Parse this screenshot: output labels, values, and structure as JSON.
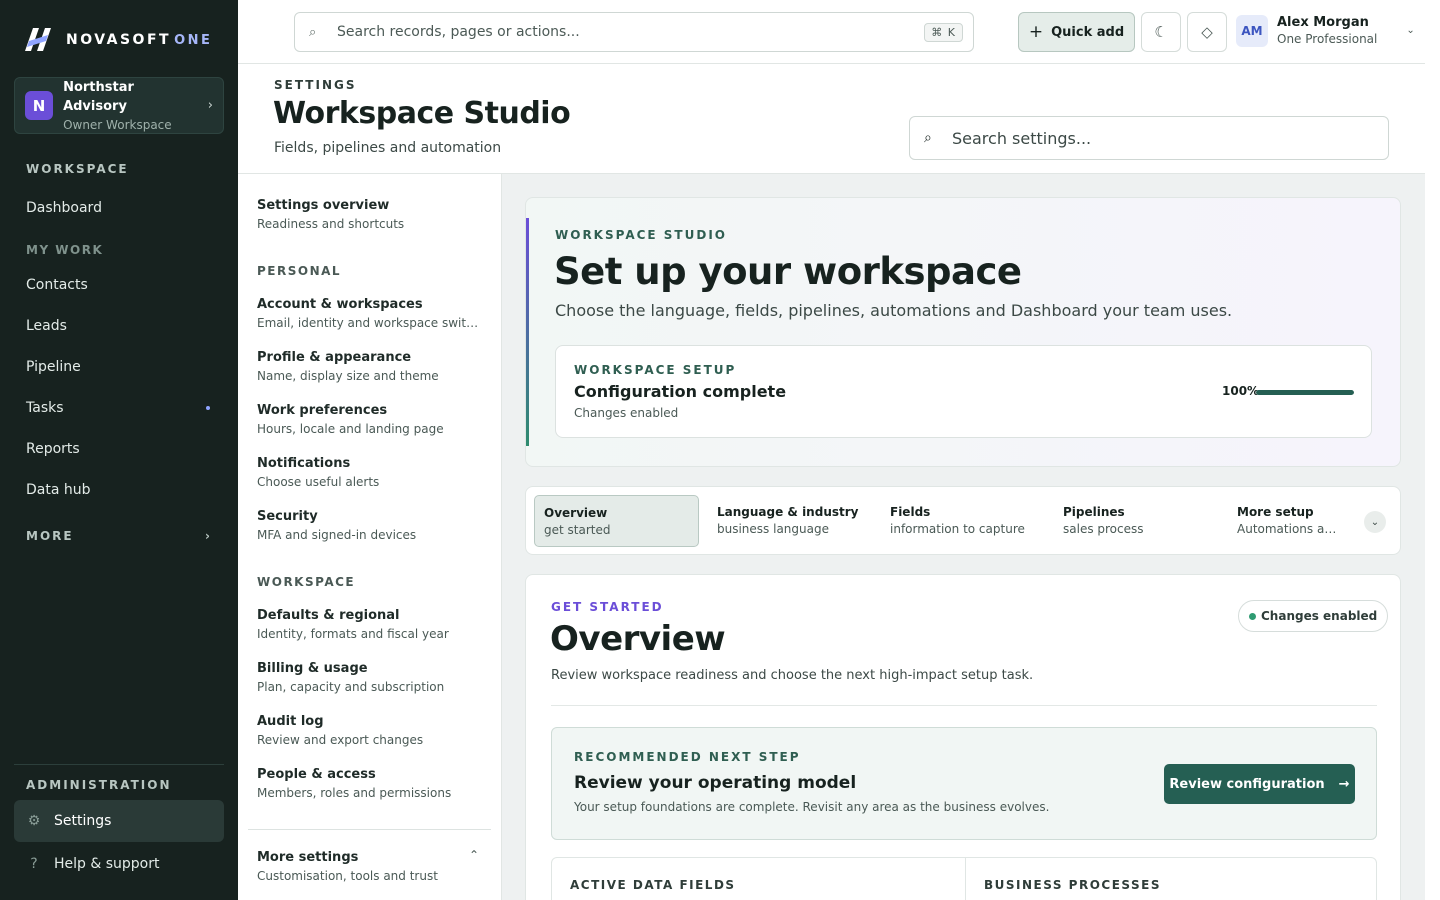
{
  "brand": {
    "name": "NOVASOFT",
    "suffix": "ONE"
  },
  "workspace_switcher": {
    "initial": "N",
    "name": "Northstar Advisory",
    "role": "Owner Workspace"
  },
  "sidebar": {
    "workspace_heading": "WORKSPACE",
    "dashboard": "Dashboard",
    "my_work_heading": "MY WORK",
    "items": [
      {
        "label": "Contacts"
      },
      {
        "label": "Leads"
      },
      {
        "label": "Pipeline"
      },
      {
        "label": "Tasks"
      },
      {
        "label": "Reports"
      },
      {
        "label": "Data hub"
      }
    ],
    "more": "MORE",
    "admin_heading": "ADMINISTRATION",
    "settings": "Settings",
    "help": "Help & support"
  },
  "topbar": {
    "search_placeholder": "Search records, pages or actions...",
    "shortcut": "⌘ K",
    "quick_add": "Quick add",
    "user": {
      "initials": "AM",
      "name": "Alex Morgan",
      "plan": "One Professional"
    }
  },
  "header": {
    "eyebrow": "SETTINGS",
    "title": "Workspace Studio",
    "subtitle": "Fields, pipelines and automation",
    "search_placeholder": "Search settings..."
  },
  "settings_nav": {
    "overview": {
      "title": "Settings overview",
      "desc": "Readiness and shortcuts"
    },
    "personal_heading": "PERSONAL",
    "personal": [
      {
        "title": "Account & workspaces",
        "desc": "Email, identity and workspace switching"
      },
      {
        "title": "Profile & appearance",
        "desc": "Name, display size and theme"
      },
      {
        "title": "Work preferences",
        "desc": "Hours, locale and landing page"
      },
      {
        "title": "Notifications",
        "desc": "Choose useful alerts"
      },
      {
        "title": "Security",
        "desc": "MFA and signed-in devices"
      }
    ],
    "workspace_heading": "WORKSPACE",
    "workspace": [
      {
        "title": "Defaults & regional",
        "desc": "Identity, formats and fiscal year"
      },
      {
        "title": "Billing & usage",
        "desc": "Plan, capacity and subscription"
      },
      {
        "title": "Audit log",
        "desc": "Review and export changes"
      },
      {
        "title": "People & access",
        "desc": "Members, roles and permissions"
      }
    ],
    "more": {
      "title": "More settings",
      "desc": "Customisation, tools and trust"
    }
  },
  "hero": {
    "eyebrow": "WORKSPACE STUDIO",
    "title": "Set up your workspace",
    "subtitle": "Choose the language, fields, pipelines, automations and Dashboard your team uses.",
    "setup": {
      "eyebrow": "WORKSPACE SETUP",
      "title": "Configuration complete",
      "status": "Changes enabled",
      "progress_label": "100%",
      "progress": 1.0
    }
  },
  "tabs": [
    {
      "title": "Overview",
      "desc": "get started"
    },
    {
      "title": "Language & industry",
      "desc": "business language"
    },
    {
      "title": "Fields",
      "desc": "information to capture"
    },
    {
      "title": "Pipelines",
      "desc": "sales process"
    },
    {
      "title": "More setup",
      "desc": "Automations and Dashboard"
    }
  ],
  "overview": {
    "eyebrow": "GET STARTED",
    "title": "Overview",
    "subtitle": "Review workspace readiness and choose the next high-impact setup task.",
    "badge": "Changes enabled",
    "recommendation": {
      "eyebrow": "RECOMMENDED NEXT STEP",
      "title": "Review your operating model",
      "desc": "Your setup foundations are complete. Revisit any area as the business evolves.",
      "button": "Review configuration"
    },
    "stats": [
      {
        "label": "ACTIVE DATA FIELDS"
      },
      {
        "label": "BUSINESS PROCESSES"
      }
    ]
  },
  "colors": {
    "accent": "#255f53",
    "brand": "#6b4ed8",
    "sidebar": "#17221f"
  }
}
